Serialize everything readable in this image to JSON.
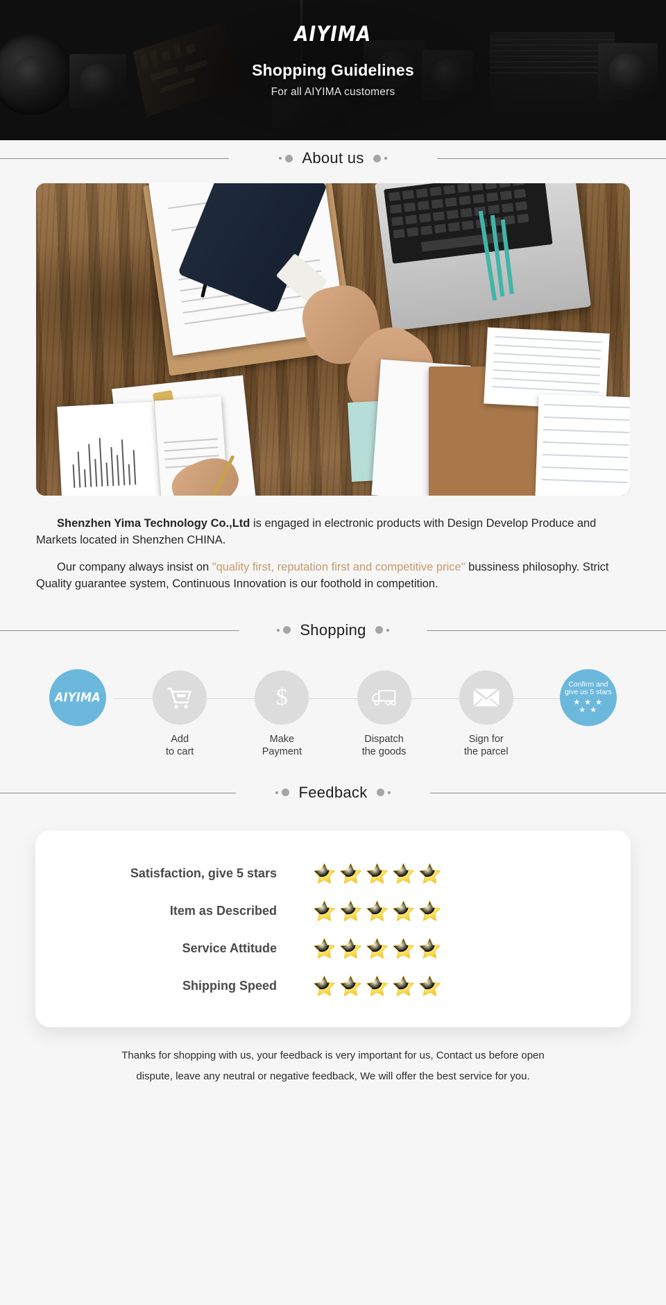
{
  "banner": {
    "logo": "AIYIMA",
    "title": "Shopping Guidelines",
    "subtitle": "For all AIYIMA customers"
  },
  "sections": {
    "about": "About us",
    "shopping": "Shopping",
    "feedback": "Feedback"
  },
  "about": {
    "image_alt": "business-handshake-photo",
    "paragraph1_strong": "Shenzhen Yima Technology Co.,Ltd",
    "paragraph1_rest": " is engaged in electronic products with Design Develop Produce and Markets located in Shenzhen CHINA.",
    "paragraph2_pre": "Our company always insist on ",
    "paragraph2_quote": "\"quality first, reputation first and competitive price\"",
    "paragraph2_post": " bussiness philosophy. Strict Quality guarantee system, Continuous Innovation is our foothold in competition."
  },
  "process": {
    "steps": [
      {
        "icon": "aiyima-logo",
        "badge_text": "AIYIMA",
        "label_line1": "",
        "label_line2": "",
        "highlight": true
      },
      {
        "icon": "cart-icon",
        "label_line1": "Add",
        "label_line2": "to cart",
        "highlight": false
      },
      {
        "icon": "dollar-icon",
        "label_line1": "Make",
        "label_line2": "Payment",
        "highlight": false
      },
      {
        "icon": "truck-icon",
        "label_line1": "Dispatch",
        "label_line2": "the goods",
        "highlight": false
      },
      {
        "icon": "envelope-icon",
        "label_line1": "Sign for",
        "label_line2": "the parcel",
        "highlight": false
      },
      {
        "icon": "stars-icon",
        "badge_line1": "Confirm and",
        "badge_line2": "give us 5 stars",
        "stars_top": "★ ★ ★",
        "stars_bottom": "★ ★",
        "label_line1": "",
        "label_line2": "",
        "highlight": true
      }
    ]
  },
  "feedback": {
    "rows": [
      {
        "label": "Satisfaction, give 5 stars",
        "stars": 5
      },
      {
        "label": "Item as Described",
        "stars": 5
      },
      {
        "label": "Service Attitude",
        "stars": 5
      },
      {
        "label": "Shipping Speed",
        "stars": 5
      }
    ]
  },
  "footer": {
    "line1": "Thanks for shopping with us, your feedback is very important for us, Contact us before open",
    "line2": "dispute, leave any neutral or negative feedback, We will offer the best service for you."
  },
  "colors": {
    "accent_blue": "#6cb8dc",
    "banner_bg": "#141414",
    "page_bg": "#f6f6f6",
    "quote_tan": "#c79a6b",
    "star_gold": "#f7d44c"
  }
}
